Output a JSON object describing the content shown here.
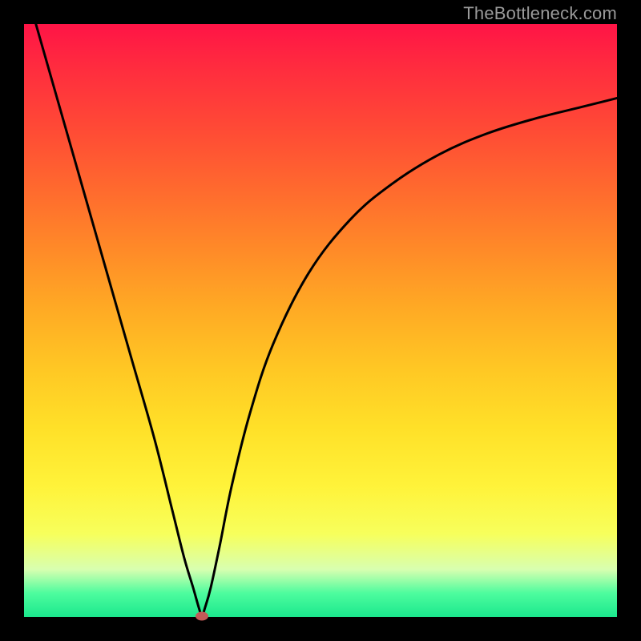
{
  "watermark": "TheBottleneck.com",
  "chart_data": {
    "type": "line",
    "title": "",
    "xlabel": "",
    "ylabel": "",
    "xlim": [
      0,
      100
    ],
    "ylim": [
      0,
      100
    ],
    "grid": false,
    "series": [
      {
        "name": "bottleneck-curve",
        "x": [
          2,
          6,
          10,
          14,
          18,
          22,
          25,
          27,
          28.5,
          29.5,
          30,
          30.5,
          31.5,
          33,
          35,
          38,
          42,
          48,
          55,
          62,
          70,
          78,
          86,
          94,
          100
        ],
        "y": [
          100,
          86,
          72,
          58,
          44,
          30,
          18,
          10,
          5,
          1.5,
          0.2,
          1.5,
          5,
          12,
          22,
          34,
          46,
          58,
          67,
          73,
          78,
          81.5,
          84,
          86,
          87.5
        ]
      }
    ],
    "marker": {
      "x": 30,
      "y": 0.2
    }
  },
  "colors": {
    "curve": "#000000",
    "marker": "#c25a58",
    "frame": "#000000"
  }
}
